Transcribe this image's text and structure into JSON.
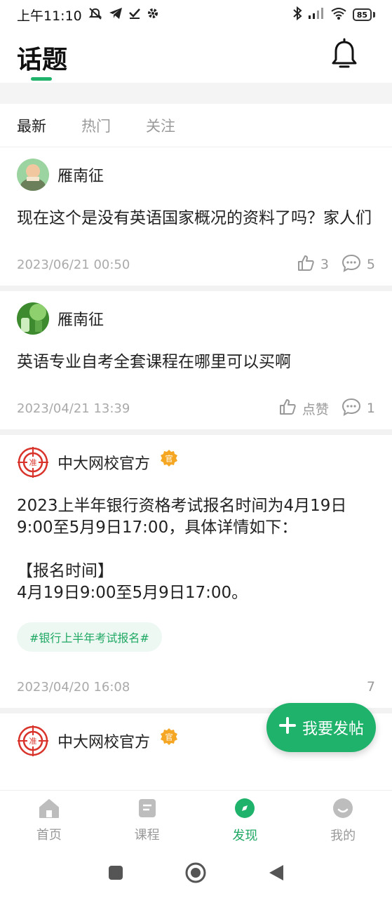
{
  "status": {
    "time": "上午11:10",
    "battery": "85"
  },
  "header": {
    "title": "话题"
  },
  "tabs": [
    {
      "label": "最新",
      "active": true
    },
    {
      "label": "热门",
      "active": false
    },
    {
      "label": "关注",
      "active": false
    }
  ],
  "posts": [
    {
      "author": "雁南征",
      "official": false,
      "content": "现在这个是没有英语国家概况的资料了吗？家人们",
      "time": "2023/06/21 00:50",
      "likes": "3",
      "comments": "5"
    },
    {
      "author": "雁南征",
      "official": false,
      "content": "英语专业自考全套课程在哪里可以买啊",
      "time": "2023/04/21 13:39",
      "likes": "点赞",
      "comments": "1"
    },
    {
      "author": "中大网校官方",
      "official": true,
      "badge_text": "官",
      "content": "2023上半年银行资格考试报名时间为4月19日9:00至5月9日17:00，具体详情如下：\n\n【报名时间】\n4月19日9:00至5月9日17:00。",
      "hashtag": "#银行上半年考试报名#",
      "time": "2023/04/20 16:08",
      "comments": "7"
    },
    {
      "author": "中大网校官方",
      "official": true,
      "badge_text": "官"
    }
  ],
  "fab": {
    "label": "我要发帖"
  },
  "bottom_nav": [
    {
      "label": "首页",
      "icon": "home-icon"
    },
    {
      "label": "课程",
      "icon": "course-icon"
    },
    {
      "label": "发现",
      "icon": "discover-icon",
      "active": true
    },
    {
      "label": "我的",
      "icon": "profile-icon"
    }
  ],
  "colors": {
    "accent": "#1fb26b",
    "badge": "#f5a623",
    "logo_red": "#d9342b"
  }
}
